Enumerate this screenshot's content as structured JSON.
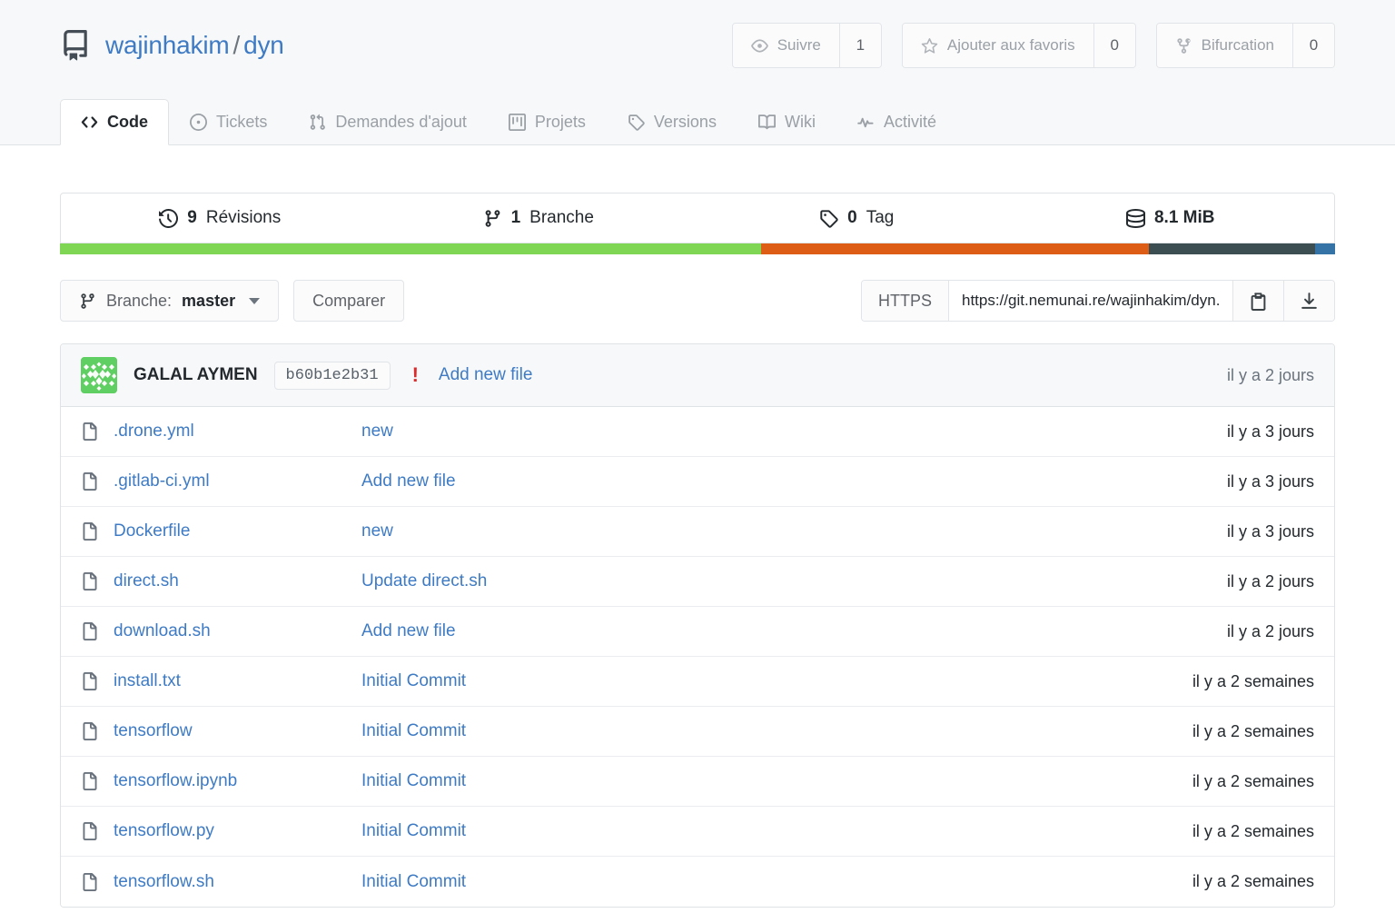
{
  "repo": {
    "icon": "repo-book-icon",
    "owner": "wajinhakim",
    "separator": "/",
    "name": "dyn"
  },
  "actions": [
    {
      "icon": "eye-icon",
      "label": "Suivre",
      "count": "1"
    },
    {
      "icon": "star-icon",
      "label": "Ajouter aux favoris",
      "count": "0"
    },
    {
      "icon": "fork-icon",
      "label": "Bifurcation",
      "count": "0"
    }
  ],
  "tabs": [
    {
      "icon": "code-icon",
      "label": "Code",
      "active": true
    },
    {
      "icon": "issue-icon",
      "label": "Tickets",
      "active": false
    },
    {
      "icon": "pull-request-icon",
      "label": "Demandes d'ajout",
      "active": false
    },
    {
      "icon": "project-icon",
      "label": "Projets",
      "active": false
    },
    {
      "icon": "tag-icon",
      "label": "Versions",
      "active": false
    },
    {
      "icon": "book-icon",
      "label": "Wiki",
      "active": false
    },
    {
      "icon": "activity-icon",
      "label": "Activité",
      "active": false
    }
  ],
  "stats": [
    {
      "icon": "history-icon",
      "count": "9",
      "label": "Révisions"
    },
    {
      "icon": "branch-icon",
      "count": "1",
      "label": "Branche"
    },
    {
      "icon": "tag-icon",
      "count": "0",
      "label": "Tag"
    },
    {
      "icon": "database-icon",
      "count": "8.1 MiB",
      "label": ""
    }
  ],
  "languages": [
    {
      "name": "lang-green",
      "color": "#7fd554",
      "percent": 55.0
    },
    {
      "name": "lang-orange",
      "color": "#dd5c16",
      "percent": 30.4
    },
    {
      "name": "lang-slate",
      "color": "#3d4e53",
      "percent": 13.0
    },
    {
      "name": "lang-blue",
      "color": "#3572a5",
      "percent": 1.6
    }
  ],
  "toolbar": {
    "branch_prefix": "Branche:",
    "branch_name": "master",
    "compare_label": "Comparer",
    "clone_protocol": "HTTPS",
    "clone_url": "https://git.nemunai.re/wajinhakim/dyn.git",
    "copy_icon": "clipboard-icon",
    "download_icon": "download-icon"
  },
  "latest_commit": {
    "avatar": "identicon-avatar",
    "author": "GALAL AYMEN",
    "hash": "b60b1e2b31",
    "warning_icon": "!",
    "message": "Add new file",
    "time": "il y a 2 jours"
  },
  "files": [
    {
      "icon": "file-icon",
      "name": ".drone.yml",
      "message": "new",
      "time": "il y a 3 jours"
    },
    {
      "icon": "file-icon",
      "name": ".gitlab-ci.yml",
      "message": "Add new file",
      "time": "il y a 3 jours"
    },
    {
      "icon": "file-icon",
      "name": "Dockerfile",
      "message": "new",
      "time": "il y a 3 jours"
    },
    {
      "icon": "file-icon",
      "name": "direct.sh",
      "message": "Update direct.sh",
      "time": "il y a 2 jours"
    },
    {
      "icon": "file-icon",
      "name": "download.sh",
      "message": "Add new file",
      "time": "il y a 2 jours"
    },
    {
      "icon": "file-icon",
      "name": "install.txt",
      "message": "Initial Commit",
      "time": "il y a 2 semaines"
    },
    {
      "icon": "file-icon",
      "name": "tensorflow",
      "message": "Initial Commit",
      "time": "il y a 2 semaines"
    },
    {
      "icon": "file-icon",
      "name": "tensorflow.ipynb",
      "message": "Initial Commit",
      "time": "il y a 2 semaines"
    },
    {
      "icon": "file-icon",
      "name": "tensorflow.py",
      "message": "Initial Commit",
      "time": "il y a 2 semaines"
    },
    {
      "icon": "file-icon",
      "name": "tensorflow.sh",
      "message": "Initial Commit",
      "time": "il y a 2 semaines"
    }
  ],
  "colors": {
    "link": "#3e7bc4",
    "muted": "#6a737d",
    "border": "#e0e3e6",
    "header_bg": "#f7f8f9",
    "danger": "#d92b2b",
    "avatar_green": "#5fce63"
  }
}
